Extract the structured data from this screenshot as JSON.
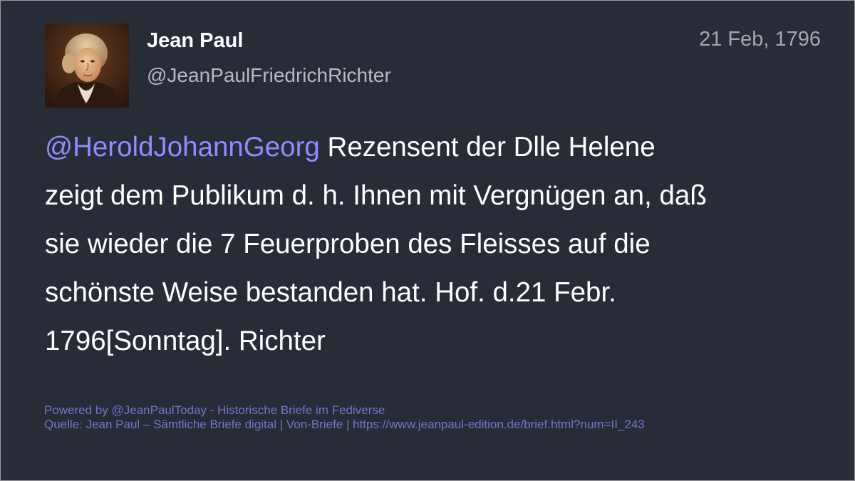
{
  "post": {
    "display_name": "Jean Paul",
    "handle": "@JeanPaulFriedrichRichter",
    "date": "21 Feb, 1796",
    "mention": "@HeroldJohannGeorg",
    "text_line1": " Rezensent der Dlle Helene",
    "text_line2": "zeigt dem Publikum d. h. Ihnen mit Vergnügen an, daß",
    "text_line3": "sie wieder die 7 Feuerproben des Fleisses auf die",
    "text_line4": "schönste Weise bestanden hat. Hof. d.21 Febr.",
    "text_line5": "1796[Sonntag]. Richter"
  },
  "footer": {
    "powered_by": "Powered by @JeanPaulToday - Historische Briefe im Fediverse",
    "source": "Quelle: Jean Paul – Sämtliche Briefe digital | Von-Briefe | https://www.jeanpaul-edition.de/brief.html?num=II_243"
  },
  "colors": {
    "background": "#282c37",
    "mention": "#8c8dff",
    "footer": "#7375c9",
    "text": "#ffffff"
  }
}
